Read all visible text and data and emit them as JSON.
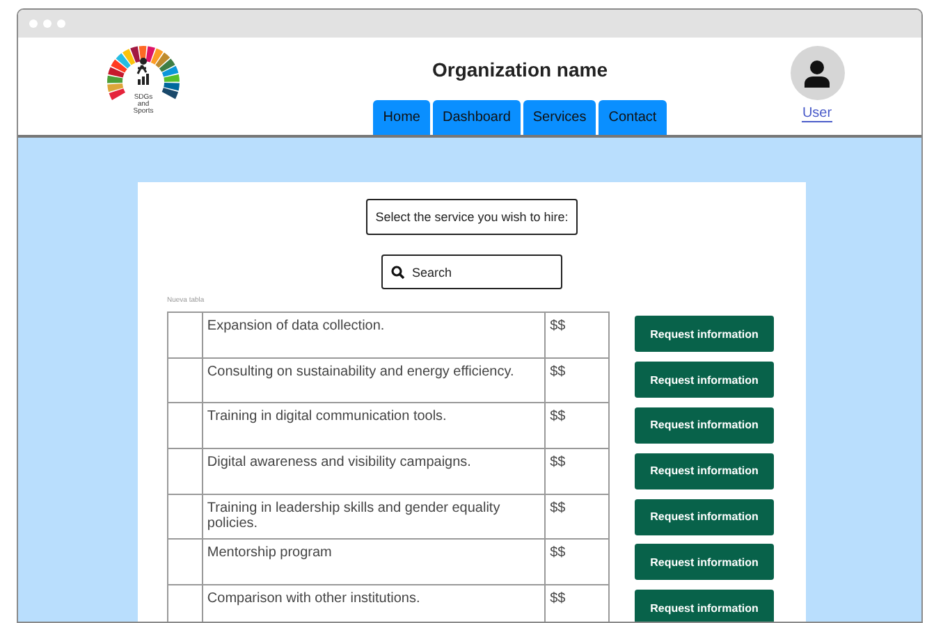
{
  "logo": {
    "lines": [
      "SDGs",
      "and",
      "Sports"
    ]
  },
  "header": {
    "title": "Organization name",
    "user_label": "User"
  },
  "nav": [
    "Home",
    "Dashboard",
    "Services",
    "Contact"
  ],
  "prompt": "Select the service you wish to hire:",
  "search": {
    "placeholder": "Search"
  },
  "table": {
    "caption": "Nueva tabla",
    "rows": [
      {
        "column_1": "",
        "service": "Expansion of data collection.",
        "price": "$$",
        "action": "Request information"
      },
      {
        "column_1": "",
        "service": "Consulting on sustainability and energy efficiency.",
        "price": "$$",
        "action": "Request information"
      },
      {
        "column_1": "",
        "service": "Training in digital communication tools.",
        "price": "$$",
        "action": "Request information"
      },
      {
        "column_1": "",
        "service": "Digital awareness and visibility campaigns.",
        "price": "$$",
        "action": "Request information"
      },
      {
        "column_1": "",
        "service": "Training in leadership skills and gender equality policies.",
        "price": "$$",
        "action": "Request information"
      },
      {
        "column_1": "",
        "service": "Mentorship program",
        "price": "$$",
        "action": "Request information"
      },
      {
        "column_1": "",
        "service": "Comparison with other institutions.",
        "price": "$$",
        "action": "Request information"
      }
    ]
  }
}
